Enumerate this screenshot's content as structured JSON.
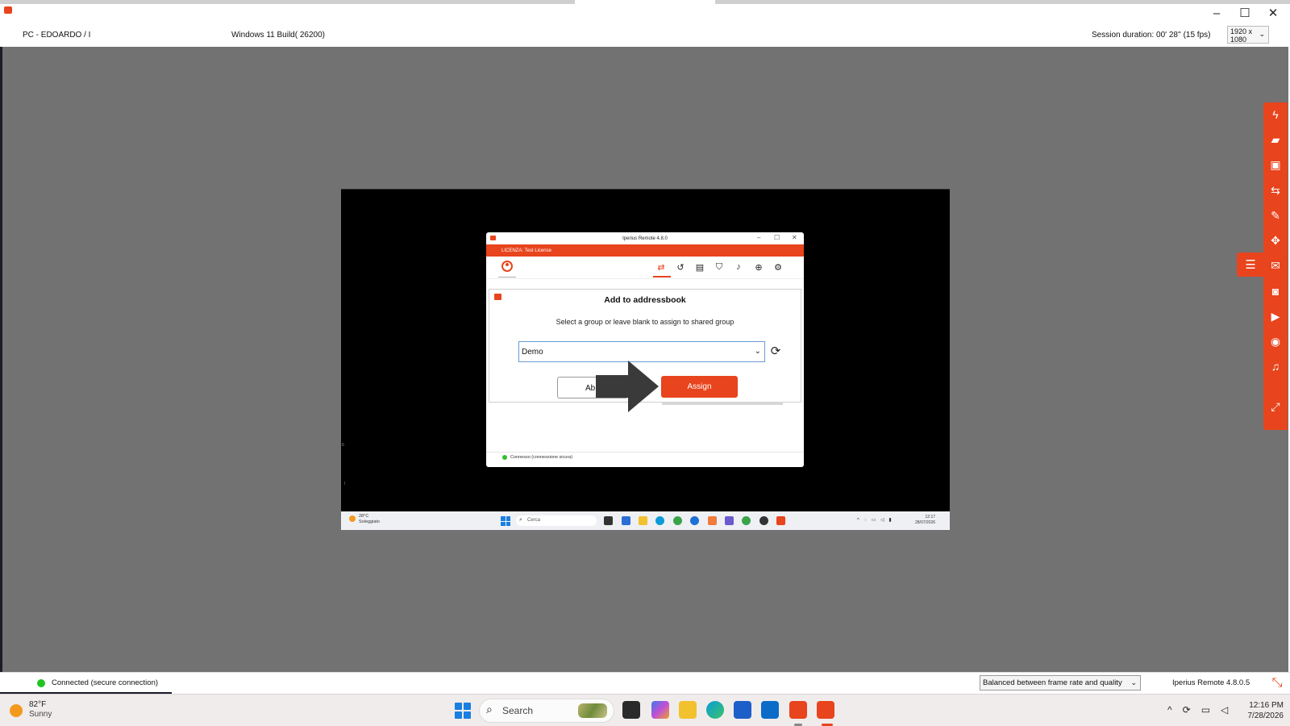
{
  "viewer": {
    "pc_name": "PC - EDOARDO / I",
    "os_info": "Windows 11 Build( 26200)",
    "session_duration": "Session duration: 00' 28'' (15 fps)",
    "resolution": "1920 x 1080",
    "window_controls": {
      "minimize": "–",
      "maximize": "☐",
      "close": "✕"
    },
    "accent_color": "#e8441d"
  },
  "remote": {
    "app_title": "Iperius Remote 4.8.0",
    "license": "LICENZA: Test License",
    "nav_icons": [
      "transfer-icon",
      "history-icon",
      "addressbook-icon",
      "shield-icon",
      "bell-icon",
      "support-icon",
      "settings-icon"
    ],
    "dialog": {
      "title": "Add to addressbook",
      "subtitle": "Select a group or leave blank to assign to shared group",
      "selected_group": "Demo",
      "abort_label": "Ab",
      "assign_label": "Assign"
    },
    "status_text": "Connesso (connessione sicura)",
    "taskbar": {
      "weather_temp": "28°C",
      "weather_cond": "Soleggiato",
      "search_placeholder": "Cerca",
      "time": "12:17",
      "date": "28/07/2026"
    }
  },
  "side_toolbar": {
    "icons": [
      "lightning-icon",
      "folder-icon",
      "addressbook-icon",
      "swap-icon",
      "wrench-icon",
      "fullscreen-icon",
      "chat-icon",
      "camera-icon",
      "video-icon",
      "eye-icon",
      "speaker-icon",
      "expand-icon"
    ],
    "menu_icon": "hamburger-icon"
  },
  "status_bar": {
    "connection": "Connected (secure connection)",
    "quality": "Balanced between frame rate and quality",
    "version": "Iperius Remote 4.8.0.5"
  },
  "host_taskbar": {
    "weather_temp": "82°F",
    "weather_cond": "Sunny",
    "search_placeholder": "Search",
    "time": "12:16 PM",
    "date": "7/28/2026"
  }
}
